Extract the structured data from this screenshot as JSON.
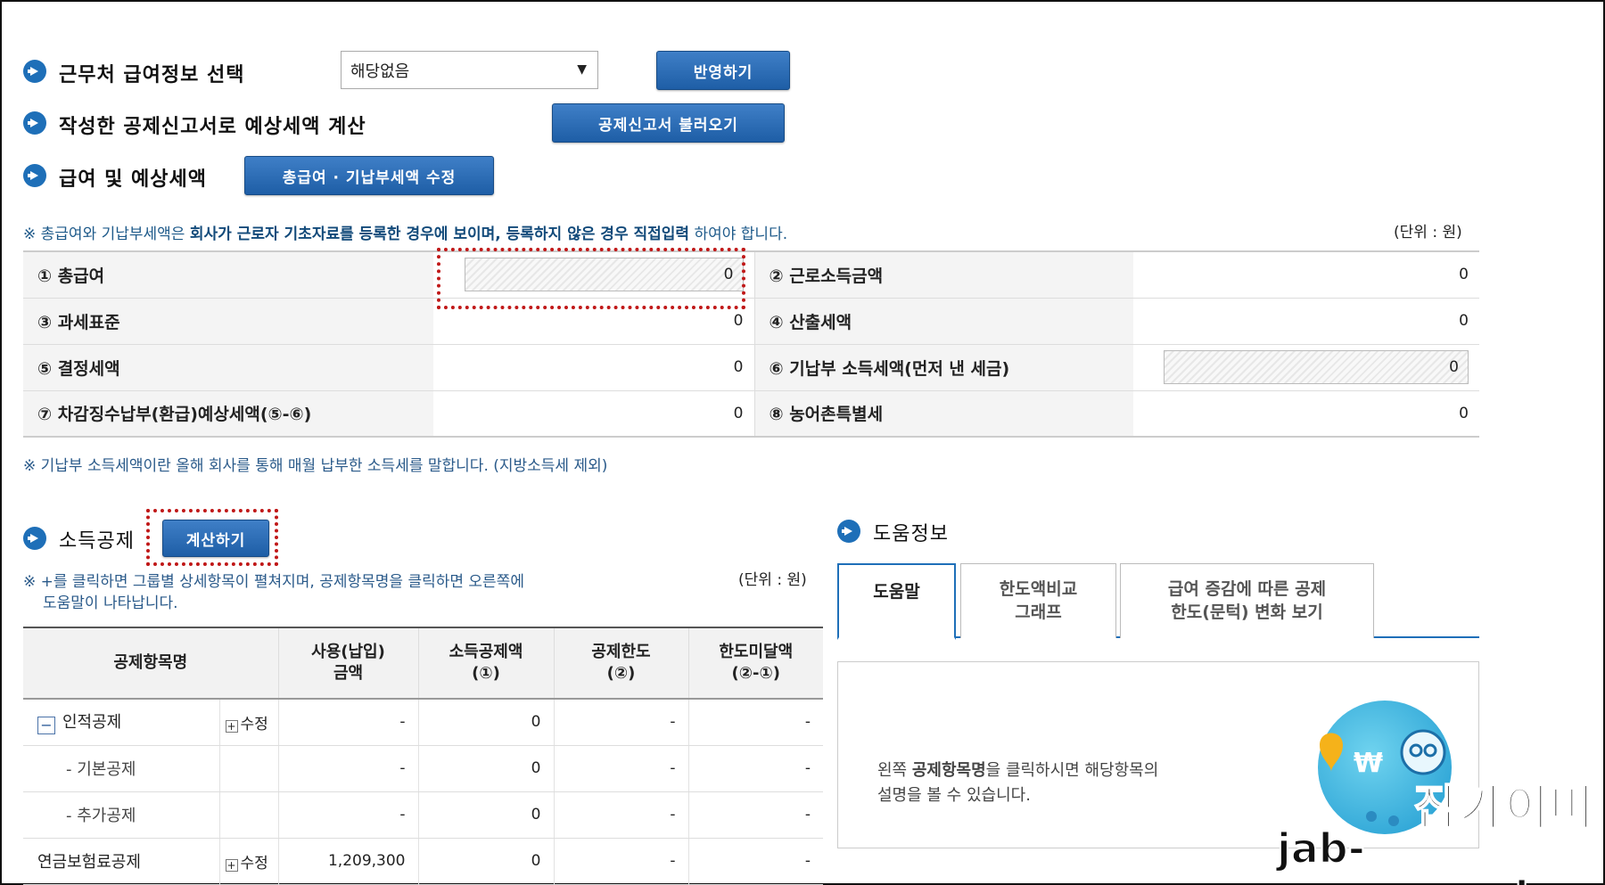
{
  "header": {
    "workplace_label": "근무처 급여정보 선택",
    "workplace_select_value": "해당없음",
    "apply_button": "반영하기",
    "calc_by_report_label": "작성한 공제신고서로 예상세액 계산",
    "load_report_button": "공제신고서 불러오기",
    "salary_tax_label": "급여 및 예상세액",
    "edit_salary_button": "총급여 · 기납부세액 수정"
  },
  "notice": {
    "prefix": "※ 총급여와 기납부세액은 ",
    "bold": "회사가 근로자 기초자료를 등록한 경우에 보이며, 등록하지 않은 경우 직접입력",
    "suffix": " 하여야 합니다.",
    "unit": "(단위 : 원)"
  },
  "summary": {
    "rows": [
      {
        "l1": "① 총급여",
        "v1": "0",
        "l2": "② 근로소득금액",
        "v2": "0"
      },
      {
        "l1": "③ 과세표준",
        "v1": "0",
        "l2": "④ 산출세액",
        "v2": "0"
      },
      {
        "l1": "⑤ 결정세액",
        "v1": "0",
        "l2": "⑥ 기납부 소득세액(먼저 낸 세금)",
        "v2": "0"
      },
      {
        "l1": "⑦ 차감징수납부(환급)예상세액(⑤-⑥)",
        "v1": "0",
        "l2": "⑧ 농어촌특별세",
        "v2": "0"
      }
    ],
    "footnote": "※ 기납부 소득세액이란 올해 회사를 통해 매월 납부한 소득세를 말합니다. (지방소득세 제외)"
  },
  "deduction": {
    "title": "소득공제",
    "calc_button": "계산하기",
    "note_line1": "※ +를 클릭하면 그룹별 상세항목이 펼쳐지며, 공제항목명을 클릭하면 오른쪽에",
    "note_line2": "도움말이 나타납니다.",
    "unit": "(단위 : 원)",
    "headers": [
      "공제항목명",
      "사용(납입)\n금액",
      "소득공제액\n(①)",
      "공제한도\n(②)",
      "한도미달액\n(②-①)"
    ],
    "rows": [
      {
        "name": "인적공제",
        "edit": "수정",
        "used": "-",
        "amount": "0",
        "limit": "-",
        "short": "-"
      },
      {
        "name": "- 기본공제",
        "edit": "",
        "used": "-",
        "amount": "0",
        "limit": "-",
        "short": "-"
      },
      {
        "name": "- 추가공제",
        "edit": "",
        "used": "-",
        "amount": "0",
        "limit": "-",
        "short": "-"
      },
      {
        "name": "연금보험료공제",
        "edit": "수정",
        "used": "1,209,300",
        "amount": "0",
        "limit": "-",
        "short": "-"
      }
    ]
  },
  "help": {
    "title": "도움정보",
    "tabs": [
      "도움말",
      "한도액비교\n그래프",
      "급여 증감에 따른 공제\n한도(문턱) 변화 보기"
    ],
    "text_pre": "왼쪽 ",
    "text_bold": "공제항목명",
    "text_post": "을 클릭하시면 해당항목의",
    "text_line2": "설명을 볼 수 있습니다."
  },
  "watermark": {
    "line1": "잡가이버",
    "line2": "jab-guyver.co.kr"
  },
  "colors": {
    "accent": "#1e6fb8",
    "highlight": "#c01818"
  }
}
